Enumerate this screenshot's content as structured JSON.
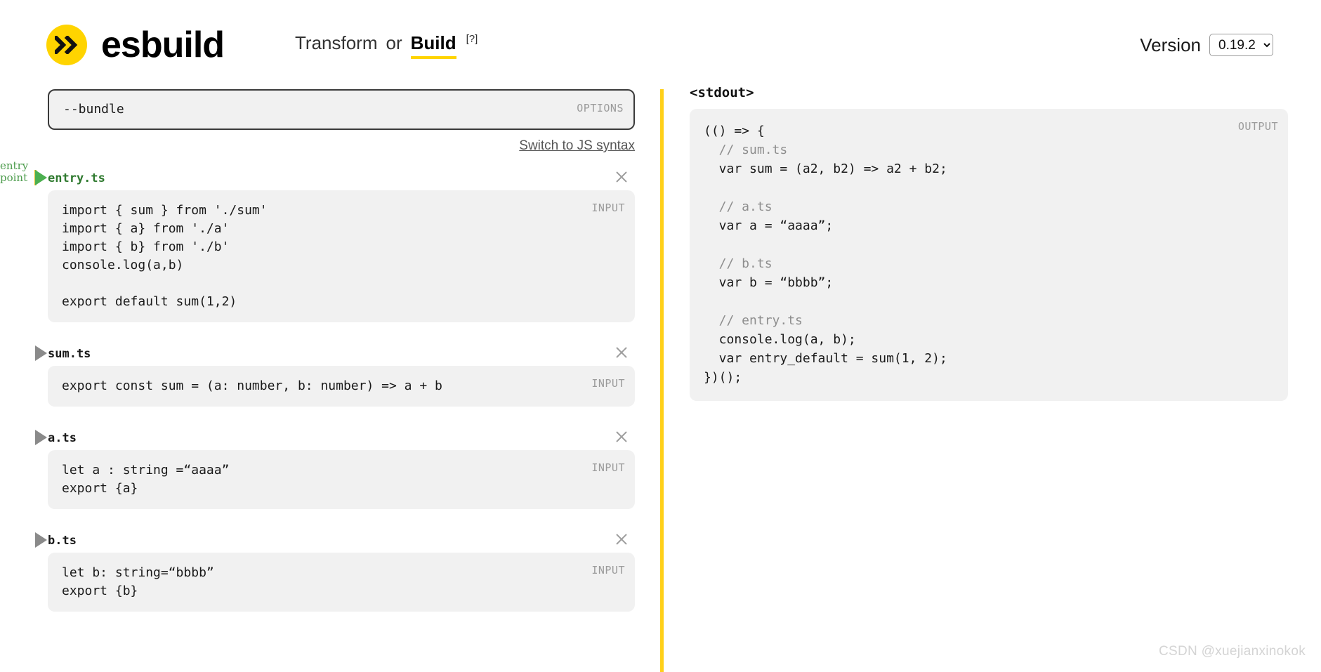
{
  "header": {
    "brand": "esbuild",
    "logo_icon": "double-chevron-icon",
    "logo_color": "#ffd400",
    "mode_transform": "Transform",
    "mode_or": "or",
    "mode_build": "Build",
    "mode_help": "[?]",
    "version_label": "Version",
    "version_value": "0.19.2",
    "version_options": [
      "0.19.2"
    ]
  },
  "left": {
    "options": {
      "value": "--bundle",
      "corner_label": "OPTIONS"
    },
    "switch_link": "Switch to JS syntax",
    "entry_point_tag": "entry\npoint",
    "files": [
      {
        "name": "entry.ts",
        "is_entry": true,
        "corner_label": "INPUT",
        "close_icon": "close-icon",
        "code": "import { sum } from './sum'\nimport { a} from './a'\nimport { b} from './b'\nconsole.log(a,b)\n\nexport default sum(1,2)"
      },
      {
        "name": "sum.ts",
        "is_entry": false,
        "corner_label": "INPUT",
        "close_icon": "close-icon",
        "code": "export const sum = (a: number, b: number) => a + b"
      },
      {
        "name": "a.ts",
        "is_entry": false,
        "corner_label": "INPUT",
        "close_icon": "close-icon",
        "code": "let a : string =“aaaa”\nexport {a}"
      },
      {
        "name": "b.ts",
        "is_entry": false,
        "corner_label": "INPUT",
        "close_icon": "close-icon",
        "code": "let b: string=“bbbb”\nexport {b}"
      }
    ]
  },
  "right": {
    "stdout_title": "<stdout>",
    "corner_label": "OUTPUT",
    "lines": [
      {
        "text": "(() => {",
        "kind": "code"
      },
      {
        "text": "  // sum.ts",
        "kind": "comment"
      },
      {
        "text": "  var sum = (a2, b2) => a2 + b2;",
        "kind": "code"
      },
      {
        "text": "",
        "kind": "blank"
      },
      {
        "text": "  // a.ts",
        "kind": "comment"
      },
      {
        "text": "  var a = “aaaa”;",
        "kind": "code"
      },
      {
        "text": "",
        "kind": "blank"
      },
      {
        "text": "  // b.ts",
        "kind": "comment"
      },
      {
        "text": "  var b = “bbbb”;",
        "kind": "code"
      },
      {
        "text": "",
        "kind": "blank"
      },
      {
        "text": "  // entry.ts",
        "kind": "comment"
      },
      {
        "text": "  console.log(a, b);",
        "kind": "code"
      },
      {
        "text": "  var entry_default = sum(1, 2);",
        "kind": "code"
      },
      {
        "text": "})();",
        "kind": "code"
      }
    ]
  },
  "watermark": "CSDN @xuejianxinokok",
  "colors": {
    "accent": "#ffd400",
    "divider": "#ffd019",
    "entry_green": "#2f7a2f",
    "code_bg": "#f1f1f1"
  }
}
